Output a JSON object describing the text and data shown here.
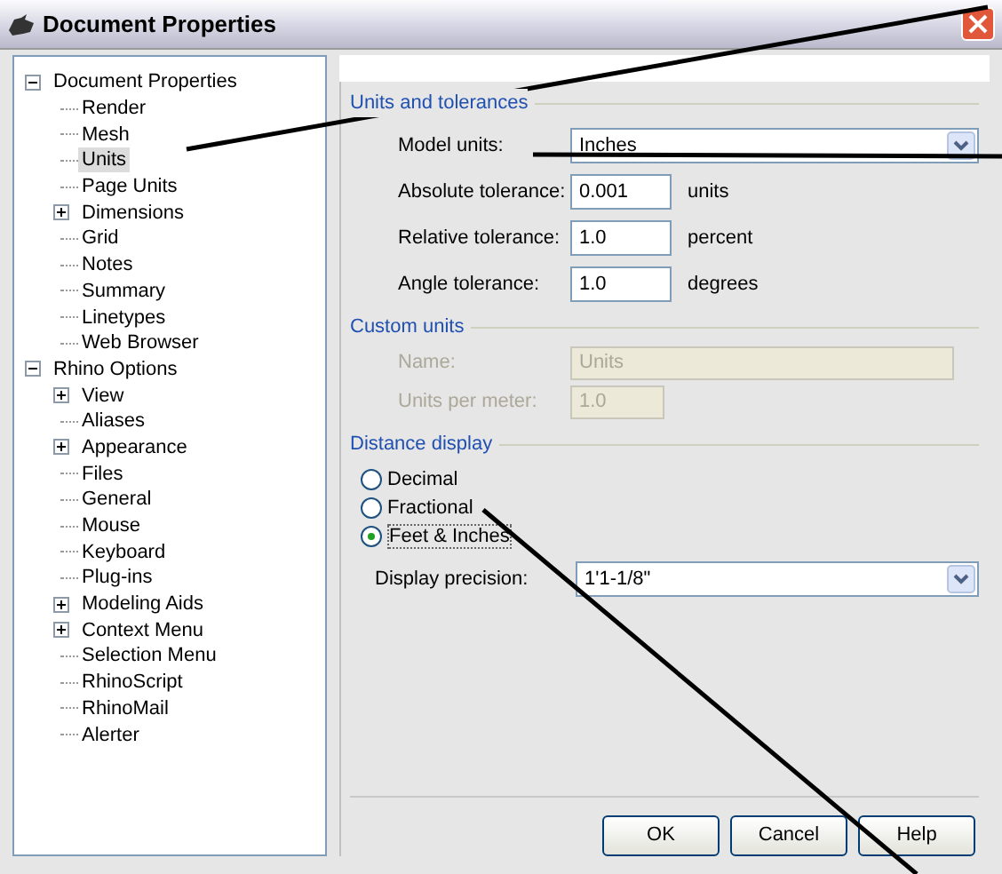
{
  "window": {
    "title": "Document Properties"
  },
  "tree": [
    {
      "label": "Document Properties",
      "expanded": true,
      "selected": false,
      "children": [
        {
          "label": "Render",
          "selected": false
        },
        {
          "label": "Mesh",
          "selected": false
        },
        {
          "label": "Units",
          "selected": true
        },
        {
          "label": "Page Units",
          "selected": false
        },
        {
          "label": "Dimensions",
          "selected": false,
          "expanded": false
        },
        {
          "label": "Grid",
          "selected": false
        },
        {
          "label": "Notes",
          "selected": false
        },
        {
          "label": "Summary",
          "selected": false
        },
        {
          "label": "Linetypes",
          "selected": false
        },
        {
          "label": "Web Browser",
          "selected": false
        }
      ]
    },
    {
      "label": "Rhino Options",
      "expanded": true,
      "selected": false,
      "children": [
        {
          "label": "View",
          "selected": false,
          "expanded": false
        },
        {
          "label": "Aliases",
          "selected": false
        },
        {
          "label": "Appearance",
          "selected": false,
          "expanded": false
        },
        {
          "label": "Files",
          "selected": false
        },
        {
          "label": "General",
          "selected": false
        },
        {
          "label": "Mouse",
          "selected": false
        },
        {
          "label": "Keyboard",
          "selected": false
        },
        {
          "label": "Plug-ins",
          "selected": false
        },
        {
          "label": "Modeling Aids",
          "selected": false,
          "expanded": false
        },
        {
          "label": "Context Menu",
          "selected": false,
          "expanded": false
        },
        {
          "label": "Selection Menu",
          "selected": false
        },
        {
          "label": "RhinoScript",
          "selected": false
        },
        {
          "label": "RhinoMail",
          "selected": false
        },
        {
          "label": "Alerter",
          "selected": false
        }
      ]
    }
  ],
  "units_group": {
    "title": "Units and tolerances",
    "model_units": {
      "label": "Model units:",
      "value": "Inches"
    },
    "rows": [
      {
        "label": "Absolute tolerance:",
        "value": "0.001",
        "unit": "units"
      },
      {
        "label": "Relative tolerance:",
        "value": "1.0",
        "unit": "percent"
      },
      {
        "label": "Angle tolerance:",
        "value": "1.0",
        "unit": "degrees"
      }
    ]
  },
  "custom_group": {
    "title": "Custom units",
    "rows": [
      {
        "label": "Name:",
        "value": "Units",
        "disabled": true,
        "wide": true
      },
      {
        "label": "Units per meter:",
        "value": "1.0",
        "disabled": true,
        "wide": false
      }
    ]
  },
  "distance_group": {
    "title": "Distance display",
    "options": [
      {
        "label": "Decimal",
        "selected": false
      },
      {
        "label": "Fractional",
        "selected": false
      },
      {
        "label": "Feet & Inches",
        "selected": true
      }
    ],
    "precision": {
      "label": "Display precision:",
      "value": "1'1-1/8\""
    }
  },
  "buttons": [
    "OK",
    "Cancel",
    "Help"
  ]
}
